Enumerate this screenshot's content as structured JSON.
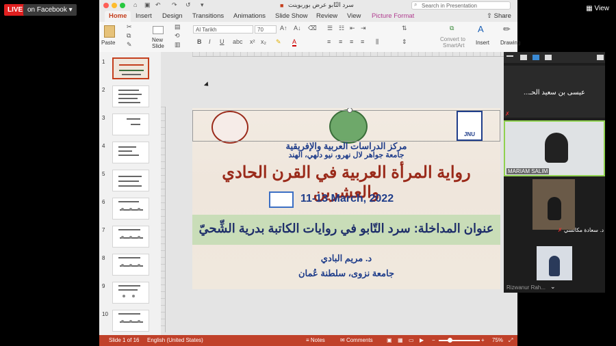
{
  "stream": {
    "live_label": "LIVE",
    "destination_label": "on Facebook",
    "view_label": "View"
  },
  "ppt": {
    "window_title": "سرد التّابو عرض بوربوينت",
    "search_placeholder": "Search in Presentation",
    "share_label": "Share",
    "tabs": [
      "Home",
      "Insert",
      "Design",
      "Transitions",
      "Animations",
      "Slide Show",
      "Review",
      "View",
      "Picture Format"
    ],
    "ribbon": {
      "paste": "Paste",
      "new_slide_1": "New",
      "new_slide_2": "Slide",
      "font_name": "Al Tarikh",
      "font_size": "70",
      "convert_1": "Convert to",
      "convert_2": "SmartArt",
      "insert": "Insert",
      "drawing": "Drawing"
    },
    "slide_numbers": [
      "1",
      "2",
      "3",
      "4",
      "5",
      "6",
      "7",
      "8",
      "9",
      "10"
    ],
    "status": {
      "slide_of": "Slide 1 of 16",
      "language": "English (United States)",
      "notes": "Notes",
      "comments": "Comments",
      "zoom": "75%"
    }
  },
  "slide": {
    "center_title_ar": "مركز الدراسات العربية والإفريقية",
    "university_ar": "جامعة جواهر لال نهرو، نيو دلهي، الهند",
    "conference_title_ar": "رواية المرأة العربية في القرن الحادي والعشرين",
    "dates": "11-13 March, 2022",
    "talk_title_ar": "عنوان المداخلة:  سرد التّابو في روايات الكاتبة بدرية الشِّحيّ",
    "speaker_ar": "د. مريم البادي",
    "affiliation_ar": "جامعة نزوى، سلطنة عُمان",
    "logo_jnu": "JNU"
  },
  "participants": {
    "top_name": "...عيسى بن سعيد الحـ",
    "p1": "MARIAM SALIM",
    "p2": "د. سعادة مكانسي",
    "p3": "Rizwanur Rah..."
  },
  "colors": {
    "accent_ppt": "#c43e1c",
    "status_bar": "#c0412a",
    "title_red": "#9a2a1a",
    "title_blue": "#1f3d8a",
    "green_band": "#c9ddb8"
  }
}
